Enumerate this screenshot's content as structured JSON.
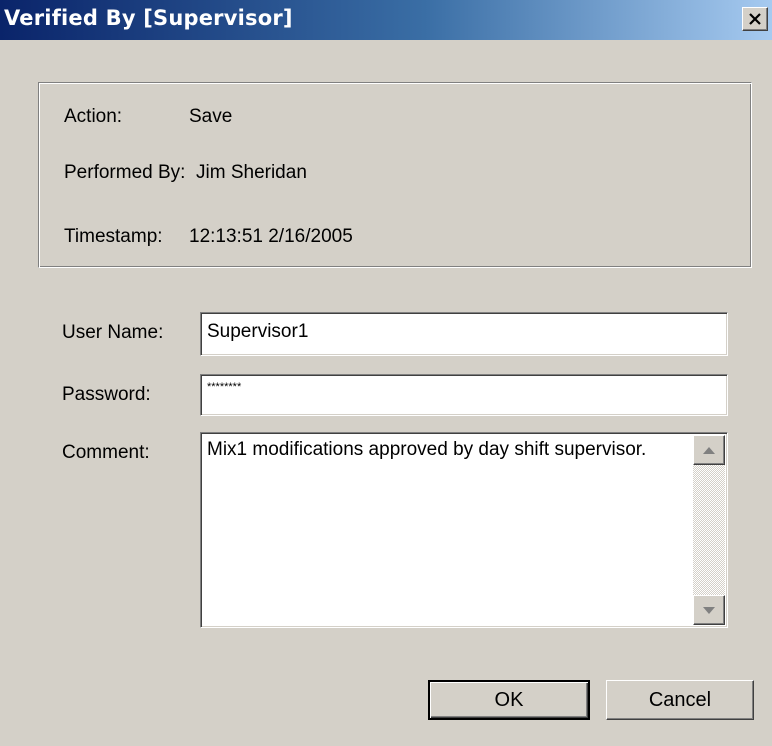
{
  "window": {
    "title": "Verified By [Supervisor]"
  },
  "info": {
    "action_label": "Action:",
    "action_value": "Save",
    "performed_by_label": "Performed By:",
    "performed_by_value": "Jim Sheridan",
    "timestamp_label": "Timestamp:",
    "timestamp_value": "12:13:51 2/16/2005"
  },
  "form": {
    "user_name_label": "User Name:",
    "user_name_value": "Supervisor1",
    "password_label": "Password:",
    "password_value": "********",
    "comment_label": "Comment:",
    "comment_value": "Mix1 modifications approved by day shift supervisor."
  },
  "buttons": {
    "ok_label": "OK",
    "cancel_label": "Cancel"
  },
  "icons": {
    "close": "close-icon",
    "scroll_up": "scroll-up-arrow-icon",
    "scroll_down": "scroll-down-arrow-icon"
  },
  "colors": {
    "titlebar_start": "#0a246a",
    "titlebar_end": "#a6caf0",
    "face": "#d4d0c8"
  }
}
